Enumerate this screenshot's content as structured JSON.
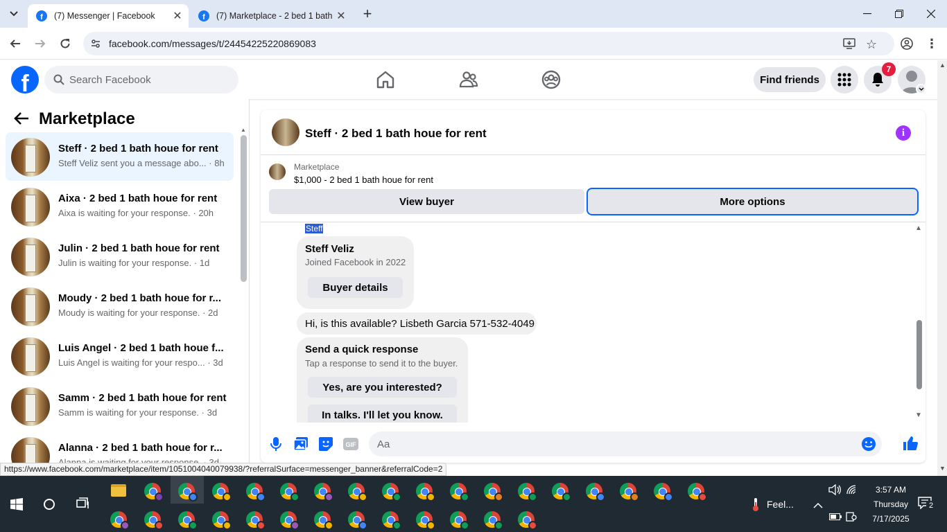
{
  "browser": {
    "tabs": [
      {
        "title": "(7) Messenger | Facebook",
        "active": true
      },
      {
        "title": "(7) Marketplace - 2 bed 1 bath h",
        "active": false
      }
    ],
    "url": "facebook.com/messages/t/24454225220869083",
    "status_url": "https://www.facebook.com/marketplace/item/1051004040079938/?referralSurface=messenger_banner&referralCode=2"
  },
  "fb_header": {
    "logo": "f",
    "search_placeholder": "Search Facebook",
    "find_friends": "Find friends",
    "notification_count": "7"
  },
  "marketplace": {
    "title": "Marketplace",
    "conversations": [
      {
        "name": "Steff · 2 bed 1 bath houe for rent",
        "preview": "Steff Veliz sent you a message abo...",
        "time": "· 8h",
        "selected": true
      },
      {
        "name": "Aixa · 2 bed 1 bath houe for rent",
        "preview": "Aixa is waiting for your response.",
        "time": "· 20h",
        "selected": false
      },
      {
        "name": "Julin · 2 bed 1 bath houe for rent",
        "preview": "Julin is waiting for your response.",
        "time": "· 1d",
        "selected": false
      },
      {
        "name": "Moudy · 2 bed 1 bath houe for r...",
        "preview": "Moudy is waiting for your response.",
        "time": "· 2d",
        "selected": false
      },
      {
        "name": "Luis Angel · 2 bed 1 bath houe f...",
        "preview": "Luis Angel is waiting for your respo...",
        "time": "· 3d",
        "selected": false
      },
      {
        "name": "Samm · 2 bed 1 bath houe for rent",
        "preview": "Samm is waiting for your response.",
        "time": "· 3d",
        "selected": false
      },
      {
        "name": "Alanna · 2 bed 1 bath houe for r...",
        "preview": "Alanna is waiting for your response.",
        "time": "· 3d",
        "selected": false
      }
    ]
  },
  "chat": {
    "title": "Steff · 2 bed 1 bath houe for rent",
    "banner_label": "Marketplace",
    "banner_listing": "$1,000 - 2 bed 1 bath houe for rent",
    "view_buyer": "View buyer",
    "more_options": "More options",
    "sender_tag": "Steff",
    "profile_card": {
      "name": "Steff Veliz",
      "joined": "Joined Facebook in 2022",
      "button": "Buyer details"
    },
    "message": "Hi, is this available? Lisbeth Garcia 571-532-4049",
    "quick_response": {
      "title": "Send a quick response",
      "subtitle": "Tap a response to send it to the buyer.",
      "options": [
        "Yes, are you interested?",
        "In talks. I'll let you know."
      ]
    },
    "composer_placeholder": "Aa"
  },
  "taskbar": {
    "weather": "Feel...",
    "time": "3:57 AM",
    "day": "Thursday",
    "date": "7/17/2025",
    "notifications": "2"
  },
  "colors": {
    "fb_blue": "#0866ff",
    "selected_bg": "#ebf5ff",
    "badge_red": "#e41e3f",
    "info_purple": "#a033ff"
  }
}
